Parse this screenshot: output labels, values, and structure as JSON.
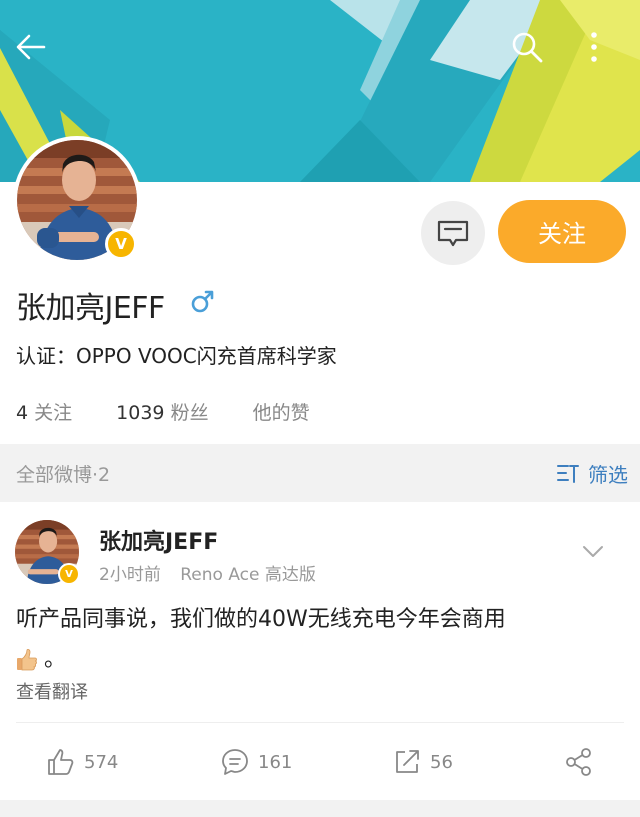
{
  "header": {
    "back_icon": "arrow-left-icon",
    "search_icon": "search-icon",
    "more_icon": "more-vertical-icon"
  },
  "profile": {
    "name": "张加亮JEFF",
    "gender_icon": "male-icon",
    "verified_icon": "verified-v-icon",
    "verified_badge_text": "V",
    "verification": "认证：OPPO VOOC闪充首席科学家",
    "message_icon": "message-icon",
    "follow_label": "关注",
    "stats": {
      "following_count": "4",
      "following_label": "关注",
      "followers_count": "1039",
      "followers_label": "粉丝",
      "likes_label": "他的赞"
    }
  },
  "filter_bar": {
    "title": "全部微博·2",
    "filter_label": "筛选",
    "filter_icon": "filter-icon"
  },
  "post": {
    "author": "张加亮JEFF",
    "time": "2小时前",
    "source": "Reno Ace 高达版",
    "text": "听产品同事说，我们做的40W无线充电今年会商用",
    "text_tail": "。",
    "emoji_icon": "thumbs-up-emoji-icon",
    "translate_label": "查看翻译",
    "like_count": "574",
    "comment_count": "161",
    "repost_count": "56"
  },
  "colors": {
    "accent_orange": "#fbaa2a",
    "link_blue": "#3e7fbf",
    "verified_gold": "#f7b500",
    "cover_teal": "#29b6c9",
    "cover_yellow": "#d8e04a"
  }
}
